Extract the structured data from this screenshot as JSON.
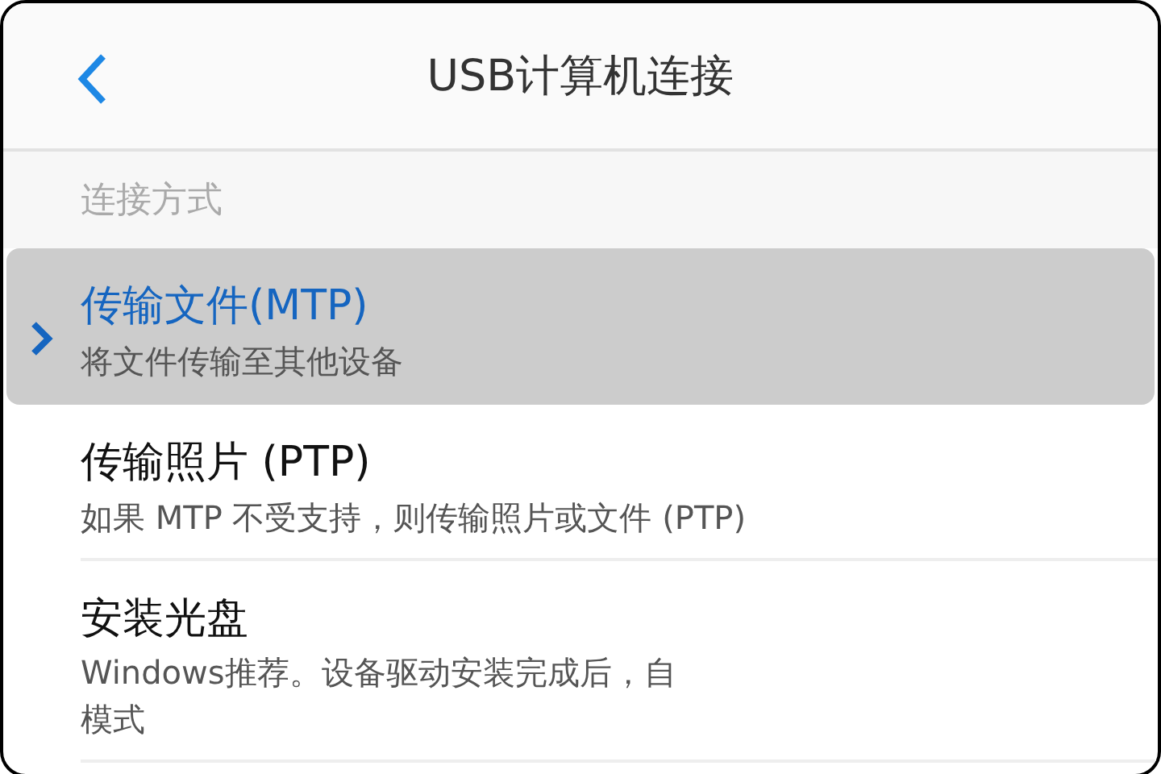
{
  "header": {
    "title": "USB计算机连接"
  },
  "section": {
    "title": "连接方式"
  },
  "options": [
    {
      "title": "传输文件(MTP)",
      "description": [
        "将文件传输至其他设备"
      ],
      "selected": true
    },
    {
      "title": "传输照片 (PTP)",
      "description": [
        "如果 MTP 不受支持，则传输照片或文件 (PTP)"
      ],
      "selected": false
    },
    {
      "title": "安装光盘",
      "description": [
        "Windows推荐。设备驱动安装完成后，自",
        "模式"
      ],
      "selected": false
    }
  ]
}
